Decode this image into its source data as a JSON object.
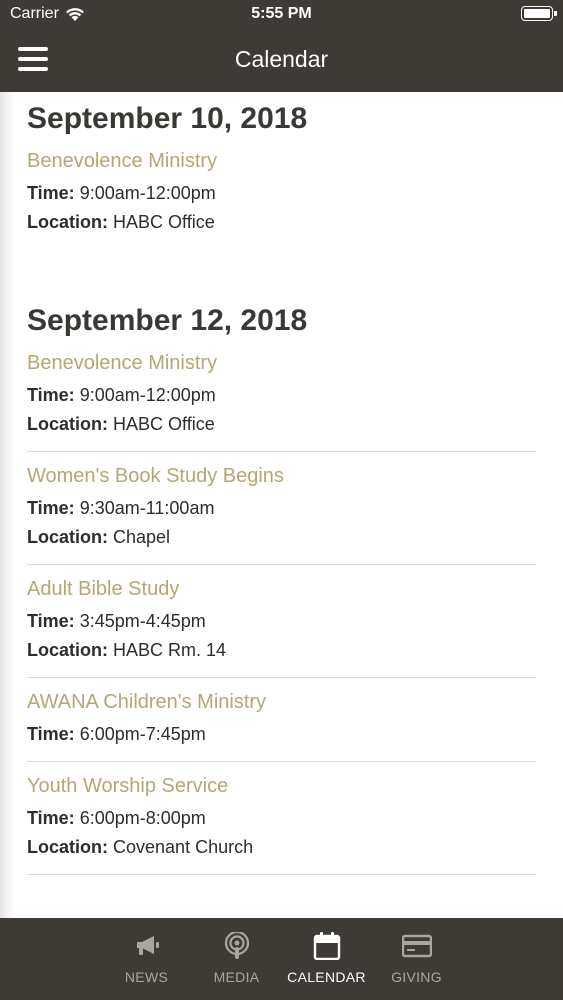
{
  "status_bar": {
    "carrier": "Carrier",
    "time": "5:55 PM"
  },
  "header": {
    "title": "Calendar"
  },
  "days": [
    {
      "date": "September 10, 2018",
      "events": [
        {
          "title": "Benevolence Ministry",
          "time_label": "Time:",
          "time": "9:00am-12:00pm",
          "location_label": "Location:",
          "location": "HABC Office"
        }
      ]
    },
    {
      "date": "September 12, 2018",
      "events": [
        {
          "title": "Benevolence Ministry",
          "time_label": "Time:",
          "time": "9:00am-12:00pm",
          "location_label": "Location:",
          "location": "HABC Office"
        },
        {
          "title": "Women's Book Study Begins",
          "time_label": "Time:",
          "time": "9:30am-11:00am",
          "location_label": "Location:",
          "location": "Chapel"
        },
        {
          "title": "Adult Bible Study",
          "time_label": "Time:",
          "time": "3:45pm-4:45pm",
          "location_label": "Location:",
          "location": "HABC Rm. 14"
        },
        {
          "title": "AWANA Children's Ministry",
          "time_label": "Time:",
          "time": "6:00pm-7:45pm"
        },
        {
          "title": "Youth Worship Service",
          "time_label": "Time:",
          "time": "6:00pm-8:00pm",
          "location_label": "Location:",
          "location": "Covenant Church"
        }
      ]
    }
  ],
  "tabs": [
    {
      "label": "NEWS",
      "icon": "megaphone-icon",
      "active": false
    },
    {
      "label": "MEDIA",
      "icon": "podcast-icon",
      "active": false
    },
    {
      "label": "CALENDAR",
      "icon": "calendar-icon",
      "active": true
    },
    {
      "label": "GIVING",
      "icon": "credit-card-icon",
      "active": false
    }
  ],
  "colors": {
    "bar": "#3e3b36",
    "event_title": "#b4a776",
    "tab_inactive": "#a9a59f",
    "tab_active": "#ffffff"
  }
}
